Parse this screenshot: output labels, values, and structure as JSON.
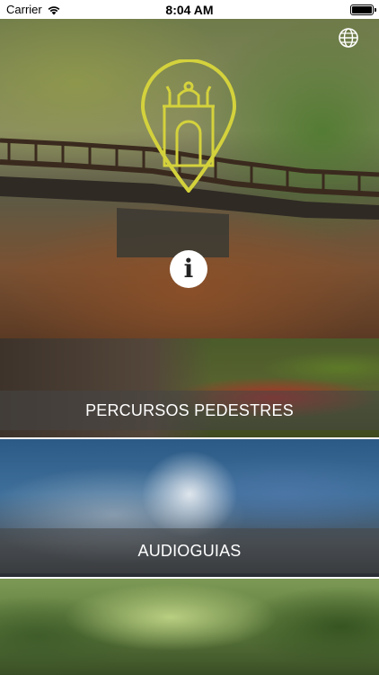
{
  "status_bar": {
    "carrier": "Carrier",
    "time": "8:04 AM",
    "battery_level": 1.0
  },
  "hero": {
    "language_icon": "globe-icon",
    "logo_icon": "map-pin-arch-icon",
    "logo_color": "#d4d23c",
    "info_icon": "info-icon"
  },
  "menu": {
    "items": [
      {
        "label": "PERCURSOS PEDESTRES"
      },
      {
        "label": "AUDIOGUIAS"
      },
      {
        "label": ""
      }
    ]
  }
}
